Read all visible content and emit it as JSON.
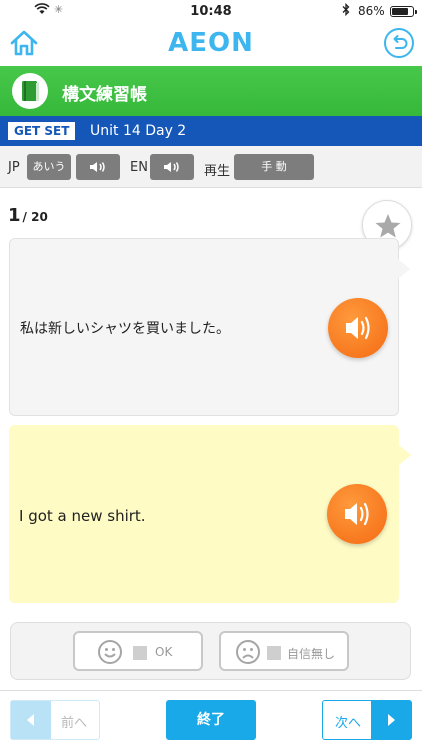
{
  "status_bar": {
    "time": "10:48",
    "battery_text": "86%",
    "battery_level": 0.86
  },
  "header": {
    "logo_text": "AEON",
    "home_icon": "home-icon",
    "back_icon": "undo-icon"
  },
  "title_bar": {
    "icon": "book-icon",
    "title": "構文練習帳",
    "color": "#3cbf3f"
  },
  "unit_bar": {
    "tag": "GET SET",
    "unit": "Unit 14 Day 2",
    "color": "#1457b8"
  },
  "controls": {
    "jp_label": "JP",
    "jp_button": "あいう",
    "en_label": "EN",
    "playback_label": "再生",
    "playback_button": "手 動"
  },
  "progress": {
    "current": "1",
    "total": "/ 20"
  },
  "cards": {
    "jp_text": "私は新しいシャツを買いました。",
    "en_text": "I got a new shirt."
  },
  "rating": {
    "ok_label": "OK",
    "not_confident_label": "自信無し"
  },
  "bottom": {
    "prev_label": "前へ",
    "end_label": "終了",
    "next_label": "次へ"
  },
  "colors": {
    "accent": "#1aa9e8",
    "speaker": "#f47a1f",
    "en_card": "#fffbc4"
  }
}
